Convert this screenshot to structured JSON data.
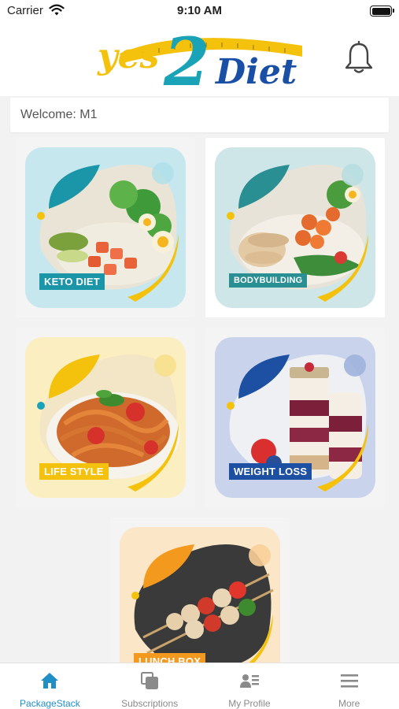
{
  "status_bar": {
    "carrier": "Carrier",
    "time": "9:10 AM"
  },
  "header": {
    "logo": {
      "text_yes": "yes",
      "text_2": "2",
      "text_diet": "Diet"
    }
  },
  "welcome": {
    "text": "Welcome: M1"
  },
  "packages": [
    {
      "label": "KETO DIET",
      "tile_color": "#c7e7ee",
      "accent": "#1a96a8"
    },
    {
      "label": "BODYBUILDING",
      "tile_color": "#cfe6e8",
      "accent": "#2a8f93"
    },
    {
      "label": "LIFE STYLE",
      "tile_color": "#fbeec0",
      "accent": "#f4c20d"
    },
    {
      "label": "WEIGHT LOSS",
      "tile_color": "#c9d4ec",
      "accent": "#1d4fa3"
    },
    {
      "label": "LUNCH BOX",
      "tile_color": "#fbe6c7",
      "accent": "#f39a1e"
    }
  ],
  "tabs": [
    {
      "label": "PackageStack",
      "icon": "home-icon",
      "active": true
    },
    {
      "label": "Subscriptions",
      "icon": "copy-icon",
      "active": false
    },
    {
      "label": "My Profile",
      "icon": "profile-card-icon",
      "active": false
    },
    {
      "label": "More",
      "icon": "menu-icon",
      "active": false
    }
  ],
  "colors": {
    "active_tab": "#1f8fc6",
    "inactive_tab": "#8a8a8a",
    "brand_yellow": "#f4c20d",
    "brand_teal": "#1aa3b7",
    "brand_blue": "#1a4fa6"
  }
}
